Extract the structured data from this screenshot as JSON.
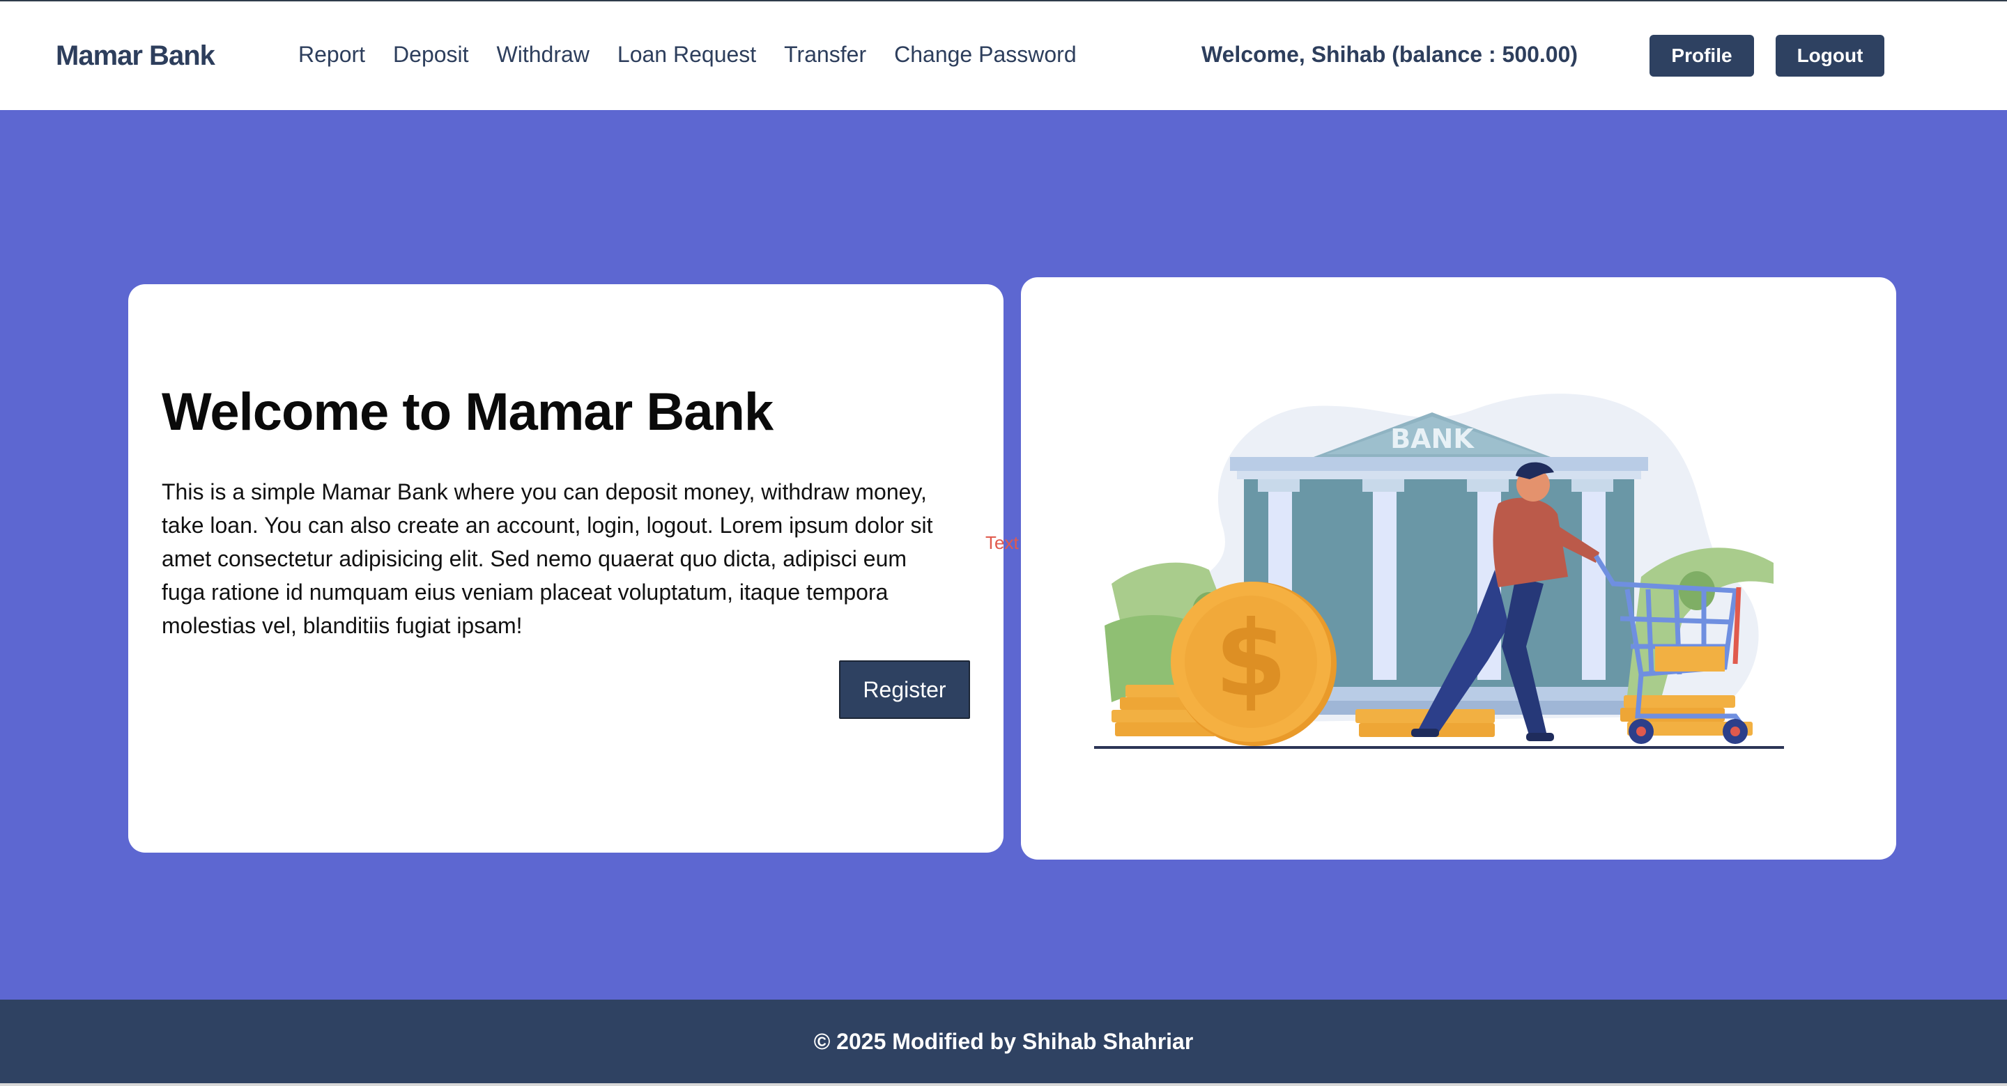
{
  "nav": {
    "brand": "Mamar Bank",
    "links": [
      "Report",
      "Deposit",
      "Withdraw",
      "Loan Request",
      "Transfer",
      "Change Password"
    ],
    "welcome": "Welcome, Shihab (balance : 500.00)",
    "profile_label": "Profile",
    "logout_label": "Logout"
  },
  "hero": {
    "title": "Welcome to Mamar Bank",
    "text": "This is a simple Mamar Bank where you can deposit money, withdraw money, take loan. You can also create an account, login, logout. Lorem ipsum dolor sit amet consectetur adipisicing elit. Sed nemo quaerat quo dicta, adipisci eum fuga ratione id numquam eius veniam placeat voluptatum, itaque tempora molestias vel, blanditiis fugiat ipsam!",
    "register_label": "Register",
    "stray_text": "Text",
    "illustration": {
      "bank_sign": "BANK",
      "icons": [
        "bank-building-icon",
        "dollar-coin-icon",
        "banknote-icon",
        "shopping-cart-icon",
        "person-icon"
      ]
    }
  },
  "footer": {
    "text": "© 2025 Modified by Shihab Shahriar"
  },
  "colors": {
    "hero_bg": "#5d67d1",
    "nav_text": "#2d3e5c",
    "button_bg": "#2e4161",
    "footer_bg": "#2f4262"
  }
}
